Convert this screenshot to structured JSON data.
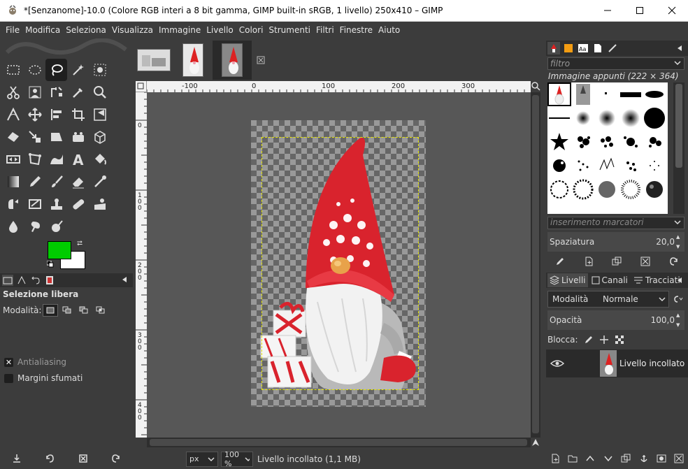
{
  "window": {
    "title": "*[Senzanome]-10.0 (Colore RGB interi a 8 bit gamma, GIMP built-in sRGB, 1 livello) 250x410 – GIMP",
    "minimize": "—",
    "maximize": "☐",
    "close": "✕"
  },
  "menu": [
    "File",
    "Modifica",
    "Seleziona",
    "Visualizza",
    "Immagine",
    "Livello",
    "Colori",
    "Strumenti",
    "Filtri",
    "Finestre",
    "Aiuto"
  ],
  "tool_options": {
    "title": "Selezione libera",
    "mode_label": "Modalità:",
    "antialiasing": "Antialiasing",
    "feather": "Margini sfumati"
  },
  "colors": {
    "foreground": "#00cc00",
    "background": "#ffffff"
  },
  "ruler": {
    "top_labels": [
      "-100",
      "0",
      "100",
      "200",
      "300"
    ],
    "left_labels": [
      "0",
      "100",
      "200",
      "300",
      "400"
    ]
  },
  "statusbar": {
    "unit": "px",
    "zoom": "100 %",
    "message": "Livello incollato (1,1 MB)"
  },
  "brushes": {
    "filter_placeholder": "filtro",
    "title": "Immagine appunti (222 × 364)",
    "tag_placeholder": "inserimento marcatori",
    "spacing_label": "Spaziatura",
    "spacing_value": "20,0"
  },
  "layers": {
    "tabs": [
      "Livelli",
      "Canali",
      "Tracciati"
    ],
    "mode_label": "Modalità",
    "mode_value": "Normale",
    "opacity_label": "Opacità",
    "opacity_value": "100,0",
    "lock_label": "Blocca:",
    "items": [
      {
        "name": "Livello incollato"
      }
    ]
  }
}
